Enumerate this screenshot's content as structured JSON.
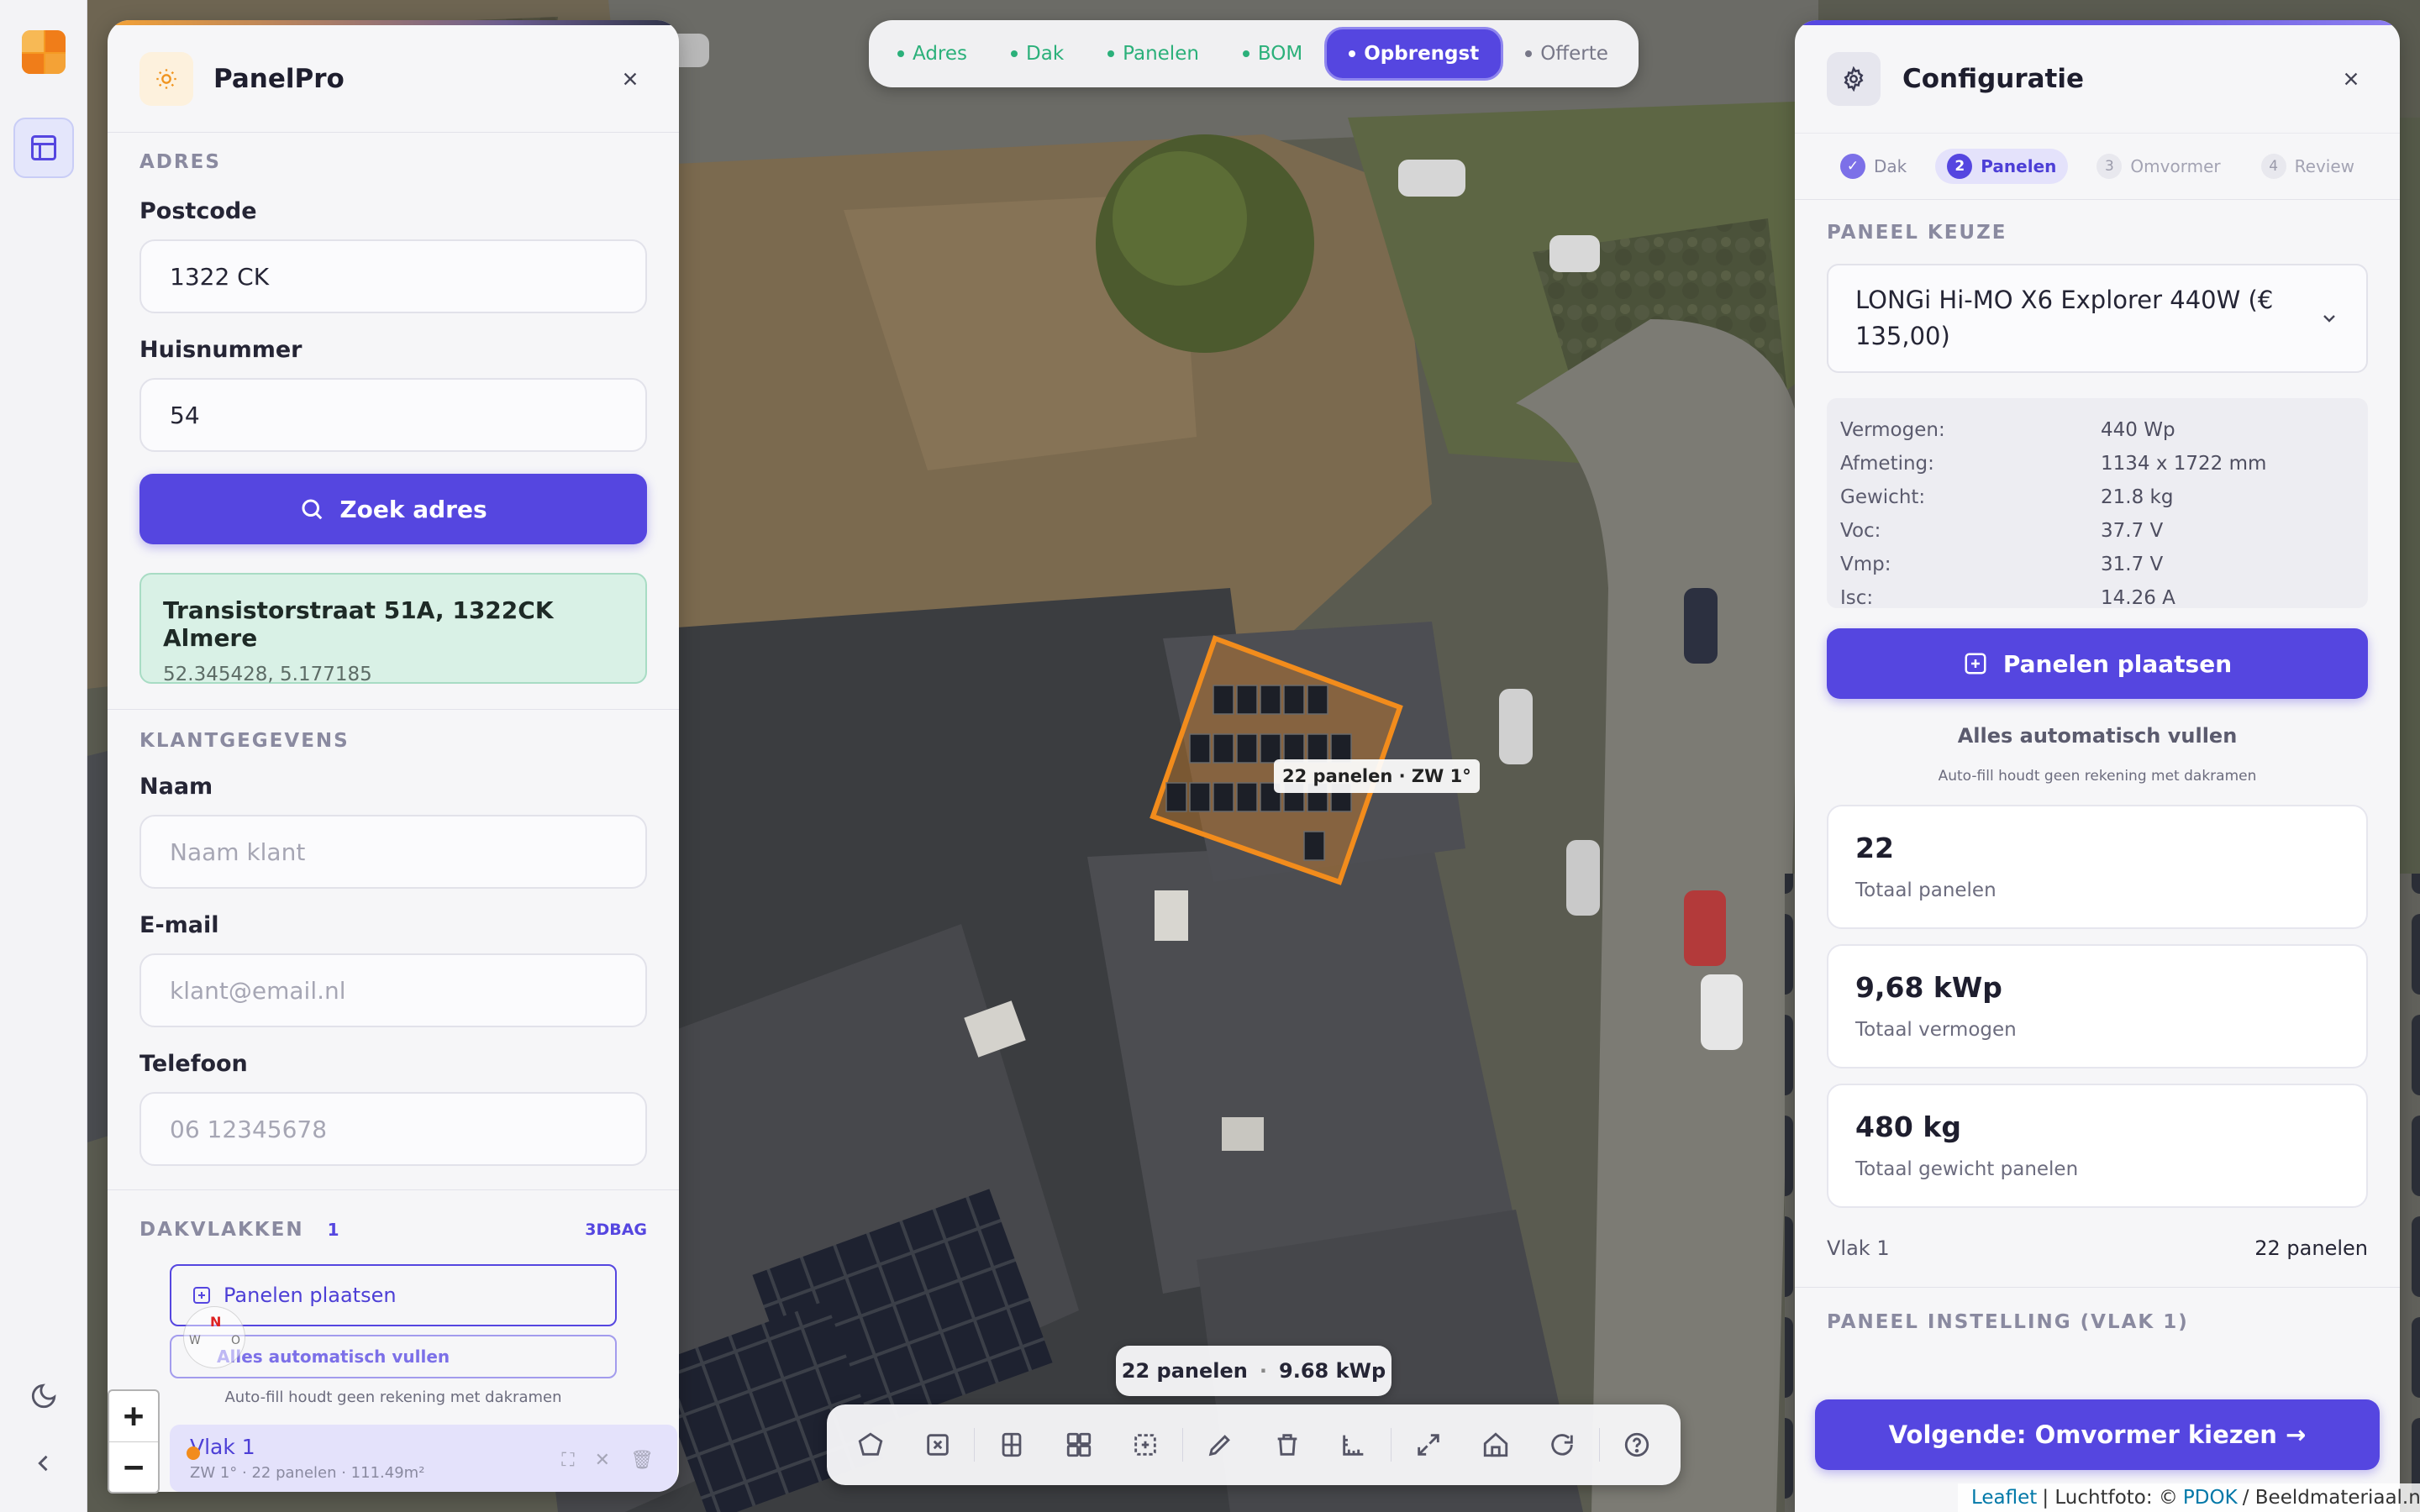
{
  "app": {
    "name": "PanelPro"
  },
  "nav_tabs": [
    {
      "label": "Adres",
      "state": "done"
    },
    {
      "label": "Dak",
      "state": "done"
    },
    {
      "label": "Panelen",
      "state": "done"
    },
    {
      "label": "BOM",
      "state": "done"
    },
    {
      "label": "Opbrengst",
      "state": "active"
    },
    {
      "label": "Offerte",
      "state": "pending"
    }
  ],
  "left_panel": {
    "title": "PanelPro",
    "adres_section": "ADRES",
    "postcode_label": "Postcode",
    "postcode_value": "1322 CK",
    "huisnummer_label": "Huisnummer",
    "huisnummer_value": "54",
    "search_button": "Zoek adres",
    "result_address": "Transistorstraat 51A, 1322CK Almere",
    "result_coords": "52.345428, 5.177185",
    "klant_section": "KLANTGEGEVENS",
    "naam_label": "Naam",
    "naam_placeholder": "Naam klant",
    "email_label": "E-mail",
    "email_placeholder": "klant@email.nl",
    "telefoon_label": "Telefoon",
    "telefoon_placeholder": "06 12345678",
    "dakvlakken_section": "DAKVLAKKEN",
    "dakvlakken_count": "1",
    "dakvlakken_source": "3DBAG",
    "place_panels_button": "Panelen plaatsen",
    "autofill_button": "Alles automatisch vullen",
    "autofill_note": "Auto-fill houdt geen rekening met dakramen",
    "vlak_name": "Vlak 1",
    "vlak_details": "ZW 1° · 22 panelen · 111.49m²"
  },
  "right_panel": {
    "title": "Configuratie",
    "steps": [
      {
        "num": "✓",
        "label": "Dak",
        "state": "done"
      },
      {
        "num": "2",
        "label": "Panelen",
        "state": "current"
      },
      {
        "num": "3",
        "label": "Omvormer",
        "state": "pending"
      },
      {
        "num": "4",
        "label": "Review",
        "state": "pending"
      }
    ],
    "panel_choice_section": "PANEEL KEUZE",
    "panel_selected": "LONGi Hi-MO X6 Explorer 440W (€ 135,00)",
    "specs": [
      {
        "key": "Vermogen:",
        "value": "440 Wp"
      },
      {
        "key": "Afmeting:",
        "value": "1134 x 1722 mm"
      },
      {
        "key": "Gewicht:",
        "value": "21.8 kg"
      },
      {
        "key": "Voc:",
        "value": "37.7 V"
      },
      {
        "key": "Vmp:",
        "value": "31.7 V"
      },
      {
        "key": "Isc:",
        "value": "14.26 A"
      }
    ],
    "place_panels_button": "Panelen plaatsen",
    "autofill_button": "Alles automatisch vullen",
    "autofill_note": "Auto-fill houdt geen rekening met dakramen",
    "stats": [
      {
        "value": "22",
        "label": "Totaal panelen"
      },
      {
        "value": "9,68 kWp",
        "label": "Totaal vermogen"
      },
      {
        "value": "480 kg",
        "label": "Totaal gewicht panelen"
      }
    ],
    "vlak_summary_name": "Vlak 1",
    "vlak_summary_count": "22 panelen",
    "panel_setting_section": "PANEEL INSTELLING (VLAK 1)",
    "next_button": "Volgende: Omvormer kiezen →"
  },
  "map": {
    "roof_label": "22 panelen · ZW 1°",
    "summary_panels": "22 panelen",
    "summary_sep": "·",
    "summary_power": "9.68 kWp",
    "zoom_in": "+",
    "zoom_out": "−",
    "compass_n": "N",
    "compass_w": "W",
    "compass_o": "O",
    "attribution_leaflet": "Leaflet",
    "attribution_sep1": "| Luchtfoto: ©",
    "attribution_pdok": "PDOK",
    "attribution_rest": "/ Beeldmateriaal.nl"
  },
  "toolbar_tools": [
    "draw-polygon-icon",
    "delete-polygon-icon",
    "grid-icon",
    "layout-grid-icon",
    "select-area-icon",
    "edit-icon",
    "trash-icon",
    "measure-icon",
    "fullscreen-icon",
    "home-icon",
    "refresh-icon",
    "help-icon"
  ],
  "colors": {
    "accent": "#5546e0",
    "success": "#2bb07a",
    "roof_outline": "#f28c1c"
  }
}
